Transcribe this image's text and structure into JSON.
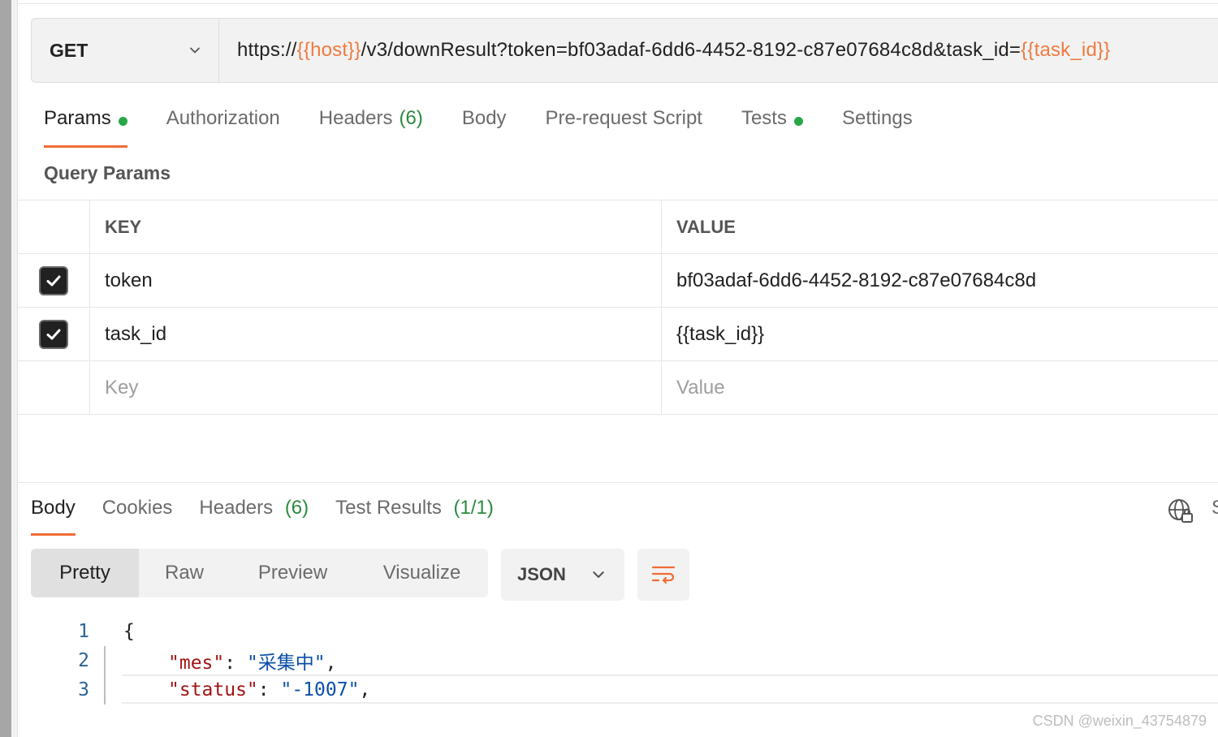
{
  "request": {
    "method": "GET",
    "url_parts": {
      "scheme": "https://",
      "host_var": "{{host}}",
      "path_query": "/v3/downResult?token=bf03adaf-6dd6-4452-8192-c87e07684c8d&task_id=",
      "task_var": "{{task_id}}"
    }
  },
  "request_tabs": [
    {
      "label": "Params"
    },
    {
      "label": "Authorization"
    },
    {
      "label": "Headers",
      "count": "(6)"
    },
    {
      "label": "Body"
    },
    {
      "label": "Pre-request Script"
    },
    {
      "label": "Tests"
    },
    {
      "label": "Settings"
    }
  ],
  "query_params": {
    "title": "Query Params",
    "headers": {
      "key": "KEY",
      "value": "VALUE"
    },
    "rows": [
      {
        "key": "token",
        "value": "bf03adaf-6dd6-4452-8192-c87e07684c8d"
      },
      {
        "key": "task_id",
        "value": "{{task_id}}"
      }
    ],
    "placeholder": {
      "key": "Key",
      "value": "Value"
    }
  },
  "response_tabs": [
    {
      "label": "Body"
    },
    {
      "label": "Cookies"
    },
    {
      "label": "Headers",
      "count": "(6)"
    },
    {
      "label": "Test Results",
      "count": "(1/1)"
    }
  ],
  "response_cut_label": "S",
  "view_modes": [
    "Pretty",
    "Raw",
    "Preview",
    "Visualize"
  ],
  "format": "JSON",
  "code": {
    "lines": [
      {
        "num": "1",
        "text": "{"
      },
      {
        "num": "2",
        "key": "\"mes\"",
        "sep": ": ",
        "val": "\"采集中\"",
        "tail": ","
      },
      {
        "num": "3",
        "key": "\"status\"",
        "sep": ": ",
        "val": "\"-1007\"",
        "tail": ","
      }
    ]
  },
  "watermark": "CSDN @weixin_43754879",
  "colors": {
    "accent": "#ef6c35",
    "variable": "#ef7a3f",
    "success_dot": "#28a745",
    "count": "#2b8a3e",
    "json_key": "#a31515",
    "json_string": "#0b4fa8"
  },
  "icons": [
    "chevron-down-icon",
    "checkmark-icon",
    "globe-lock-icon",
    "wrap-lines-icon"
  ]
}
